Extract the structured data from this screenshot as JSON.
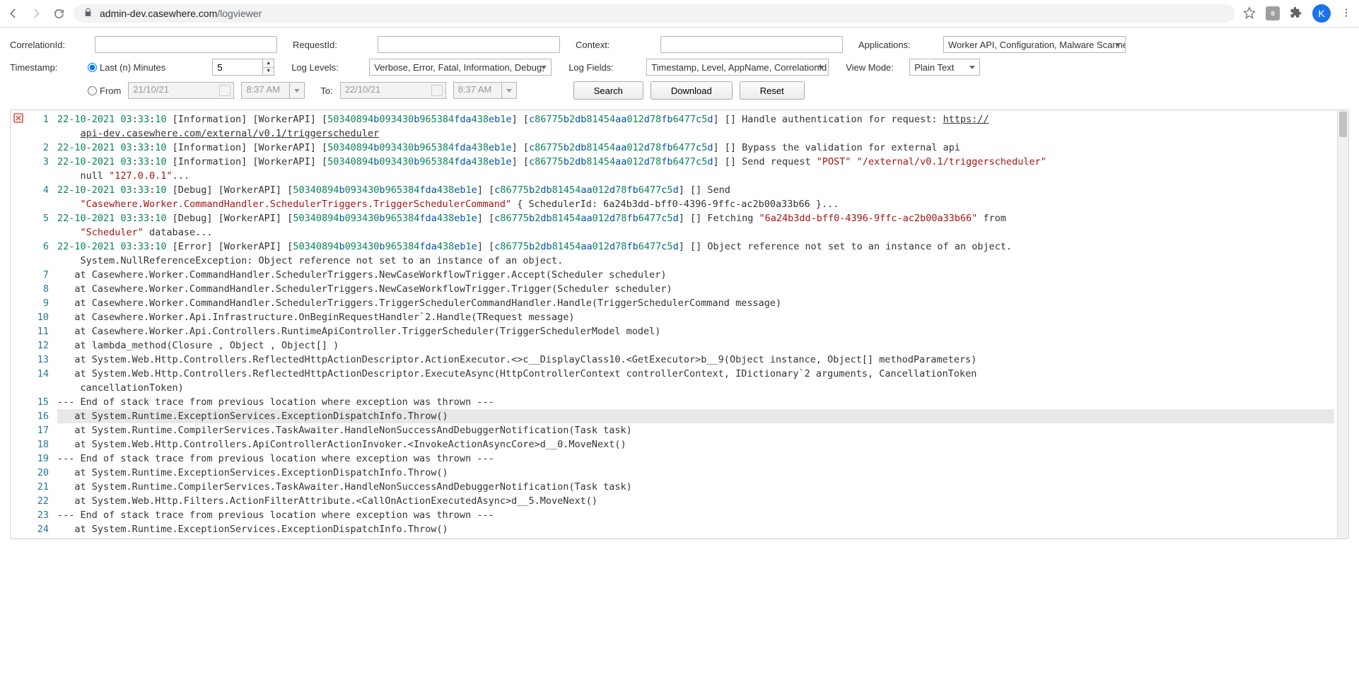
{
  "browser": {
    "url_domain": "admin-dev.casewhere.com",
    "url_path": "/logviewer",
    "ext_letter": "s",
    "avatar_letter": "K"
  },
  "filters": {
    "correlation_label": "CorrelationId:",
    "correlation_value": "",
    "request_label": "RequestId:",
    "request_value": "",
    "context_label": "Context:",
    "context_value": "",
    "applications_label": "Applications:",
    "applications_value": "Worker API, Configuration, Malware Scanner",
    "timestamp_label": "Timestamp:",
    "last_n_label": "Last (n) Minutes",
    "last_n_value": "5",
    "loglevels_label": "Log Levels:",
    "loglevels_value": "Verbose, Error, Fatal, Information, Debug,",
    "logfields_label": "Log Fields:",
    "logfields_value": "Timestamp, Level, AppName, CorrelationId",
    "viewmode_label": "View Mode:",
    "viewmode_value": "Plain Text",
    "from_label": "From",
    "from_date": "21/10/21",
    "from_time": "8:37 AM",
    "to_label": "To:",
    "to_date": "22/10/21",
    "to_time": "8:37 AM",
    "btn_search": "Search",
    "btn_download": "Download",
    "btn_reset": "Reset"
  },
  "line_count": 24,
  "log_lines": {
    "l1a": "22-10-2021 03:33:10 [Information] [WorkerAPI] [50340894b093430b965384fda438eb1e] [c86775b2db81454aa012d78fb6477c5d] [] Handle authentication for request: https://",
    "l1b": "api-dev.casewhere.com/external/v0.1/triggerscheduler",
    "l2": "22-10-2021 03:33:10 [Information] [WorkerAPI] [50340894b093430b965384fda438eb1e] [c86775b2db81454aa012d78fb6477c5d] [] Bypass the validation for external api",
    "l3a": "22-10-2021 03:33:10 [Information] [WorkerAPI] [50340894b093430b965384fda438eb1e] [c86775b2db81454aa012d78fb6477c5d] [] Send request \"POST\" \"/external/v0.1/triggerscheduler\"",
    "l3b": "null \"127.0.0.1\"...",
    "l4a": "22-10-2021 03:33:10 [Debug] [WorkerAPI] [50340894b093430b965384fda438eb1e] [c86775b2db81454aa012d78fb6477c5d] [] Send",
    "l4b": "\"Casewhere.Worker.CommandHandler.SchedulerTriggers.TriggerSchedulerCommand\" { SchedulerId: 6a24b3dd-bff0-4396-9ffc-ac2b00a33b66 }...",
    "l5a": "22-10-2021 03:33:10 [Debug] [WorkerAPI] [50340894b093430b965384fda438eb1e] [c86775b2db81454aa012d78fb6477c5d] [] Fetching \"6a24b3dd-bff0-4396-9ffc-ac2b00a33b66\" from",
    "l5b": "\"Scheduler\" database...",
    "l6a": "22-10-2021 03:33:10 [Error] [WorkerAPI] [50340894b093430b965384fda438eb1e] [c86775b2db81454aa012d78fb6477c5d] [] Object reference not set to an instance of an object.",
    "l6b": "System.NullReferenceException: Object reference not set to an instance of an object.",
    "l7": "   at Casewhere.Worker.CommandHandler.SchedulerTriggers.NewCaseWorkflowTrigger.Accept(Scheduler scheduler)",
    "l8": "   at Casewhere.Worker.CommandHandler.SchedulerTriggers.NewCaseWorkflowTrigger.Trigger(Scheduler scheduler)",
    "l9": "   at Casewhere.Worker.CommandHandler.SchedulerTriggers.TriggerSchedulerCommandHandler.Handle(TriggerSchedulerCommand message)",
    "l10": "   at Casewhere.Worker.Api.Infrastructure.OnBeginRequestHandler`2.Handle(TRequest message)",
    "l11": "   at Casewhere.Worker.Api.Controllers.RuntimeApiController.TriggerScheduler(TriggerSchedulerModel model)",
    "l12": "   at lambda_method(Closure , Object , Object[] )",
    "l13": "   at System.Web.Http.Controllers.ReflectedHttpActionDescriptor.ActionExecutor.<>c__DisplayClass10.<GetExecutor>b__9(Object instance, Object[] methodParameters)",
    "l14a": "   at System.Web.Http.Controllers.ReflectedHttpActionDescriptor.ExecuteAsync(HttpControllerContext controllerContext, IDictionary`2 arguments, CancellationToken",
    "l14b": "cancellationToken)",
    "l15": "--- End of stack trace from previous location where exception was thrown ---",
    "l16": "   at System.Runtime.ExceptionServices.ExceptionDispatchInfo.Throw()",
    "l17": "   at System.Runtime.CompilerServices.TaskAwaiter.HandleNonSuccessAndDebuggerNotification(Task task)",
    "l18": "   at System.Web.Http.Controllers.ApiControllerActionInvoker.<InvokeActionAsyncCore>d__0.MoveNext()",
    "l19": "--- End of stack trace from previous location where exception was thrown ---",
    "l20": "   at System.Runtime.ExceptionServices.ExceptionDispatchInfo.Throw()",
    "l21": "   at System.Runtime.CompilerServices.TaskAwaiter.HandleNonSuccessAndDebuggerNotification(Task task)",
    "l22": "   at System.Web.Http.Filters.ActionFilterAttribute.<CallOnActionExecutedAsync>d__5.MoveNext()",
    "l23": "--- End of stack trace from previous location where exception was thrown ---",
    "l24": "   at System.Runtime.ExceptionServices.ExceptionDispatchInfo.Throw()"
  }
}
